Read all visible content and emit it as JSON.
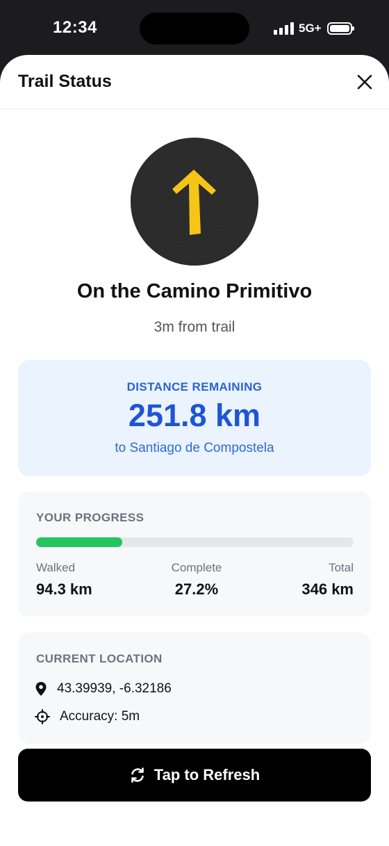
{
  "status_bar": {
    "time": "12:34",
    "network": "5G+"
  },
  "header": {
    "title": "Trail Status"
  },
  "trail": {
    "icon": "yellow-arrow-icon",
    "name": "On the Camino Primitivo",
    "distance_from_trail": "3m from trail"
  },
  "remaining": {
    "label": "DISTANCE REMAINING",
    "value": "251.8 km",
    "destination": "to Santiago de Compostela"
  },
  "progress": {
    "label": "YOUR PROGRESS",
    "fraction": 0.272,
    "walked_label": "Walked",
    "walked_value": "94.3 km",
    "complete_label": "Complete",
    "complete_value": "27.2%",
    "total_label": "Total",
    "total_value": "346 km"
  },
  "location": {
    "label": "CURRENT LOCATION",
    "coordinates": "43.39939, -6.32186",
    "accuracy": "Accuracy: 5m"
  },
  "refresh_button": {
    "label": "Tap to Refresh"
  },
  "colors": {
    "accent_blue": "#1f55d3",
    "progress_green": "#22c55e",
    "arrow_yellow": "#f5c518"
  }
}
